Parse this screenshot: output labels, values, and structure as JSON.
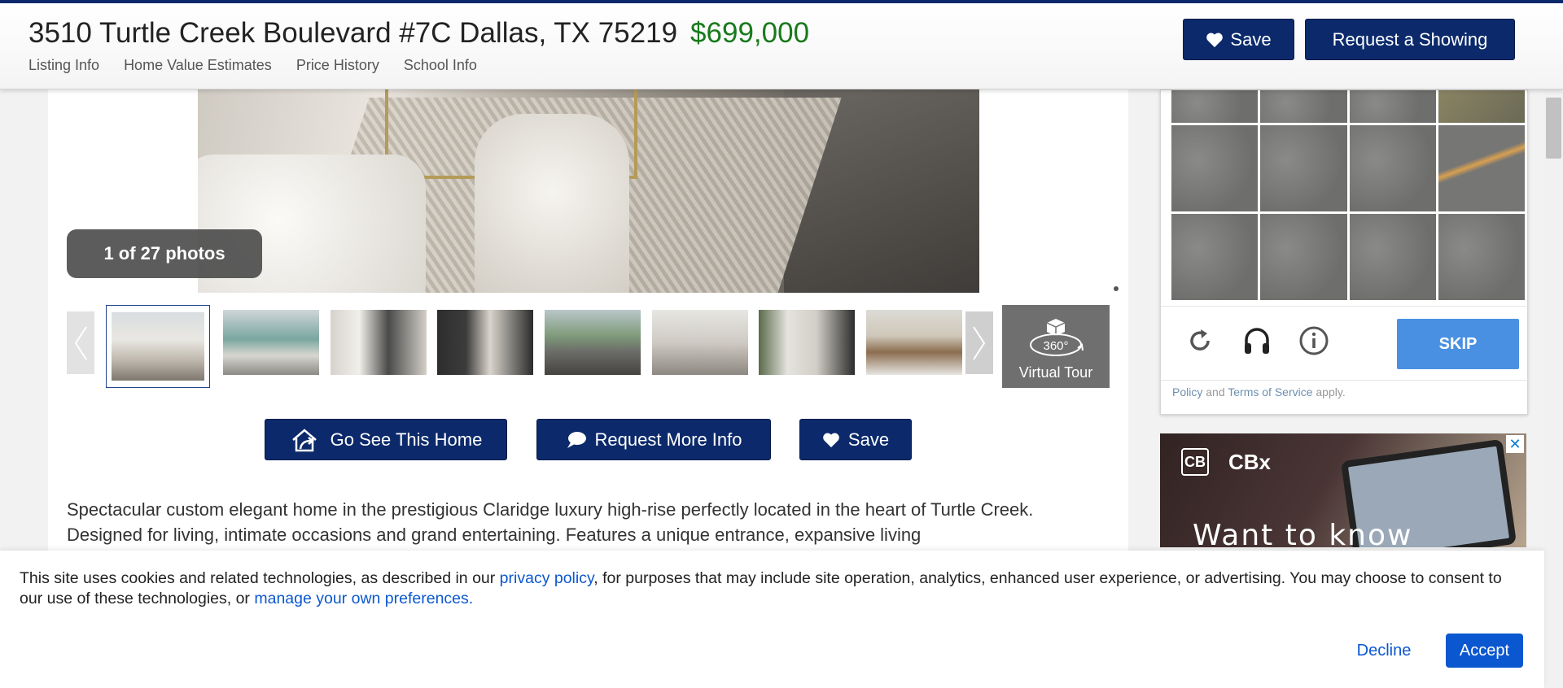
{
  "header": {
    "address": "3510 Turtle Creek Boulevard #7C Dallas, TX 75219",
    "price": "$699,000",
    "nav": [
      "Listing Info",
      "Home Value Estimates",
      "Price History",
      "School Info"
    ],
    "save_label": "Save",
    "request_showing_label": "Request a Showing"
  },
  "gallery": {
    "photo_count": "1 of 27 photos",
    "virtual_tour_label": "Virtual Tour",
    "virtual_tour_badge": "360°",
    "thumbnail_count": 8,
    "active_thumbnail": 1
  },
  "actions": {
    "go_see_label": "Go See This Home",
    "request_info_label": "Request More Info",
    "save_label": "Save"
  },
  "description": "Spectacular custom elegant home in the prestigious Claridge luxury high-rise perfectly located in the heart of Turtle Creek. Designed for living, intimate occasions and grand entertaining. Features a unique entrance, expansive living",
  "recaptcha": {
    "skip_label": "SKIP",
    "footer_policy": "Policy",
    "footer_and": "and",
    "footer_terms": "Terms of Service",
    "footer_apply": "apply.",
    "icons": [
      "reload-icon",
      "audio-icon",
      "info-icon"
    ]
  },
  "ad": {
    "logo": "CB",
    "brand": "CBx",
    "headline": "Want to know",
    "close_label": "✕"
  },
  "cookie": {
    "text_before": "This site uses cookies and related technologies, as described in our ",
    "privacy_link": "privacy policy",
    "text_middle": ", for purposes that may include site operation, analytics, enhanced user experience, or advertising. You may choose to consent to our use of these technologies, or ",
    "preferences_link": "manage your own preferences",
    "text_end": ".",
    "decline_label": "Decline",
    "accept_label": "Accept"
  },
  "colors": {
    "navy": "#0c2a6b",
    "price_green": "#187a1c",
    "link_blue": "#0b57d0",
    "skip_blue": "#4a90e2"
  }
}
